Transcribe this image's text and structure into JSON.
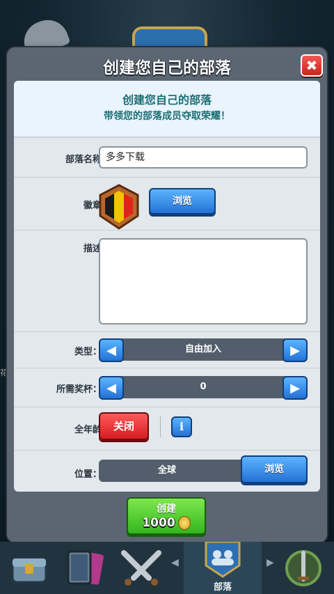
{
  "dialog": {
    "title": "创建您自己的部落",
    "close_glyph": "✖",
    "header_line1": "创建您自己的部落",
    "header_line2": "带领您的部落成员夺取荣耀！"
  },
  "form": {
    "name_label": "部落名称",
    "name_value": "多多下载",
    "badge_label": "徽章",
    "badge_browse": "浏览",
    "desc_label": "描述",
    "desc_value": "",
    "type_label": "类型：",
    "type_value": "自由加入",
    "trophy_label": "所需奖杯：",
    "trophy_value": "0",
    "family_label": "全年龄",
    "family_value": "关闭",
    "info_glyph": "i",
    "location_label": "位置：",
    "location_value": "全球",
    "location_browse": "浏览"
  },
  "create": {
    "label": "创建",
    "cost": "1000"
  },
  "nav": {
    "clan_label": "部落",
    "left_arrow": "◀",
    "right_arrow": "▶"
  },
  "side_text": "花",
  "colors": {
    "accent_blue": "#2471d6",
    "accent_red": "#d41d22",
    "accent_green": "#33b51f",
    "badge_black": "#1a1a1a",
    "badge_yellow": "#f4c400",
    "badge_red": "#e2231a"
  },
  "icons": [
    "close-icon",
    "arrow-left-icon",
    "arrow-right-icon",
    "info-icon",
    "coin-icon",
    "belgium-badge-icon",
    "chest-icon",
    "cards-icon",
    "swords-icon",
    "clan-icon",
    "laurel-icon"
  ]
}
